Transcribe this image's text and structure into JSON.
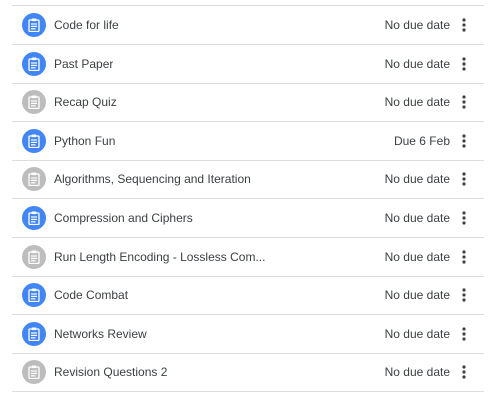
{
  "assignments": [
    {
      "title": "Code for life",
      "due": "No due date",
      "status": "active",
      "icon": "assignment-icon"
    },
    {
      "title": "Past Paper",
      "due": "No due date",
      "status": "active",
      "icon": "assignment-icon"
    },
    {
      "title": "Recap Quiz",
      "due": "No due date",
      "status": "inactive",
      "icon": "assignment-icon"
    },
    {
      "title": "Python Fun",
      "due": "Due 6 Feb",
      "status": "active",
      "icon": "assignment-icon"
    },
    {
      "title": "Algorithms, Sequencing and Iteration",
      "due": "No due date",
      "status": "inactive",
      "icon": "assignment-icon"
    },
    {
      "title": "Compression and Ciphers",
      "due": "No due date",
      "status": "active",
      "icon": "assignment-icon"
    },
    {
      "title": "Run Length Encoding - Lossless Com...",
      "due": "No due date",
      "status": "inactive",
      "icon": "assignment-icon"
    },
    {
      "title": "Code Combat",
      "due": "No due date",
      "status": "active",
      "icon": "assignment-icon"
    },
    {
      "title": "Networks Review",
      "due": "No due date",
      "status": "active",
      "icon": "assignment-icon"
    },
    {
      "title": "Revision Questions 2",
      "due": "No due date",
      "status": "inactive",
      "icon": "assignment-icon"
    }
  ],
  "colors": {
    "active_icon_bg": "#4285f4",
    "inactive_icon_bg": "#bdbdbd",
    "divider": "#dadce0",
    "text": "#3c4043",
    "more_icon": "#3c4043"
  }
}
